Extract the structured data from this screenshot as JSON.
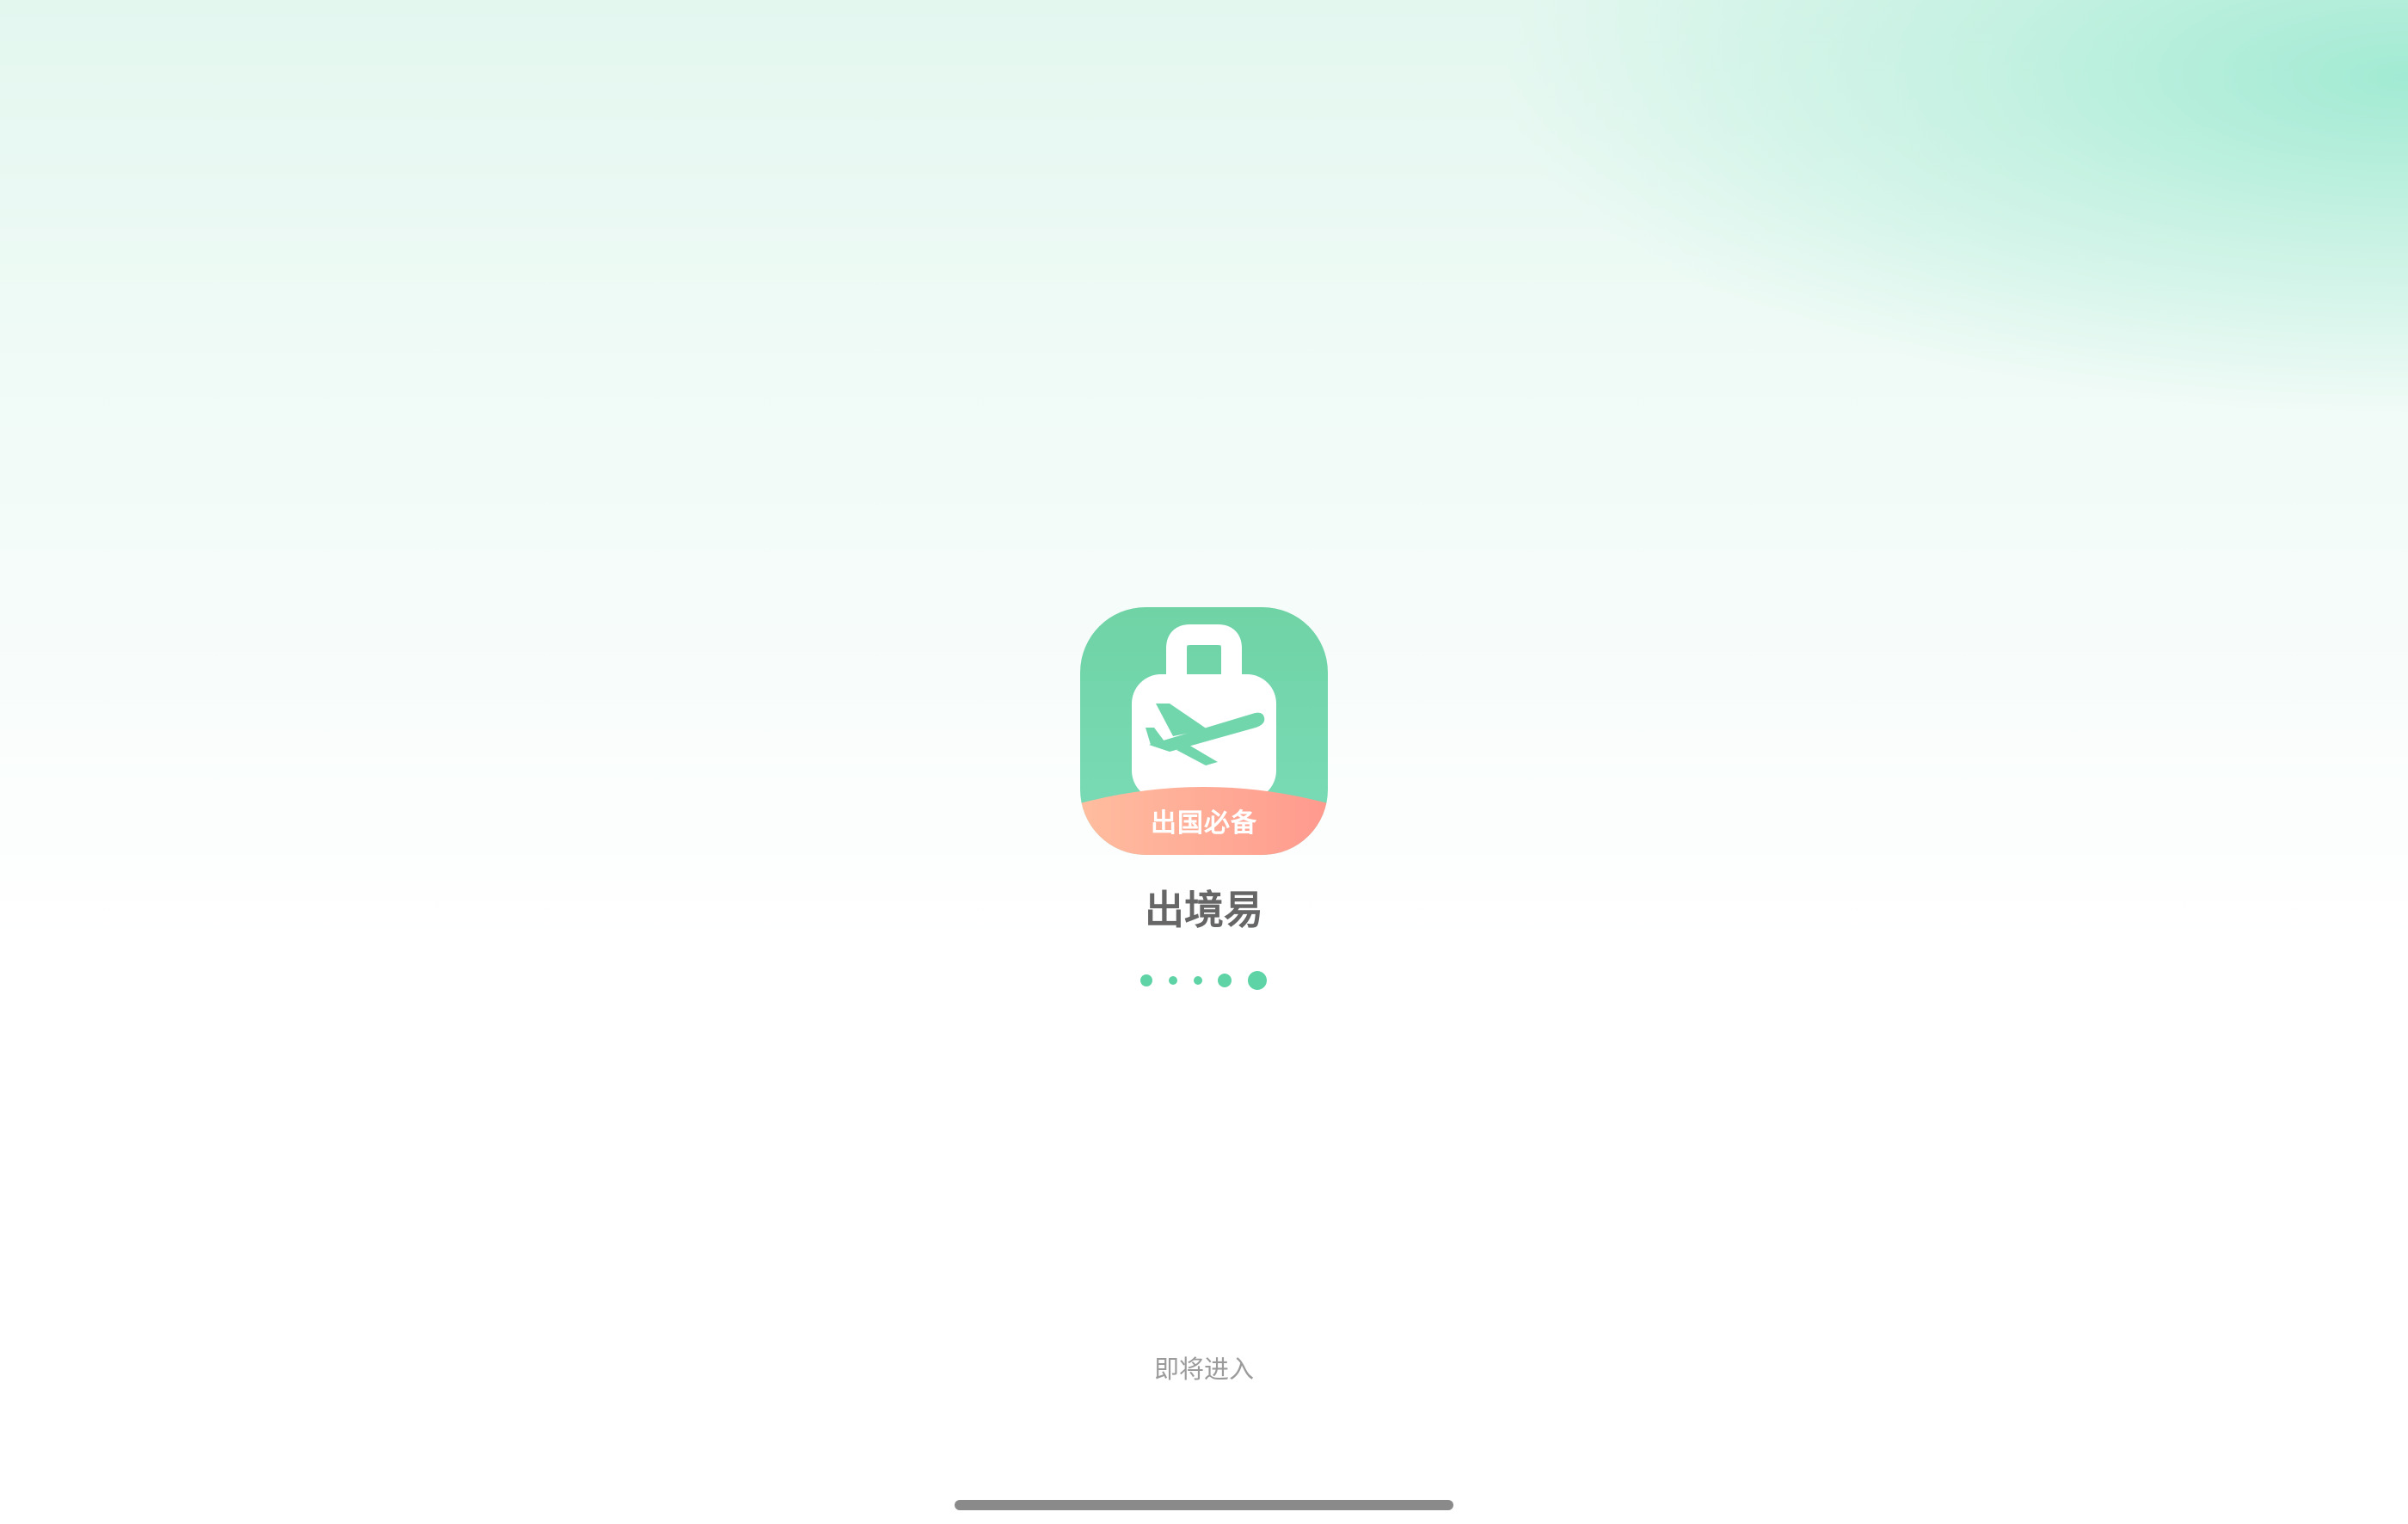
{
  "splash": {
    "icon": {
      "name": "suitcase-airplane-icon",
      "badge_text": "出国必备",
      "primary_color": "#6fd3a6",
      "badge_color": "#ffa896"
    },
    "app_name": "出境易",
    "loading_indicator": {
      "dot_count": 5,
      "color": "#5ed3a6"
    },
    "status_text": "即将进入"
  },
  "system": {
    "home_indicator": "home-indicator"
  }
}
